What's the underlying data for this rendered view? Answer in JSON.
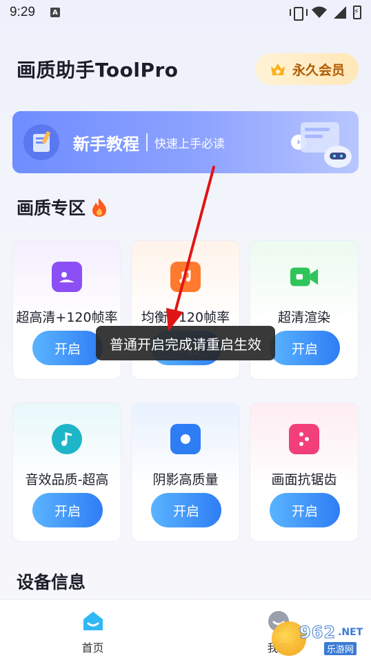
{
  "status_bar": {
    "time": "9:29",
    "notif_letter": "A"
  },
  "header": {
    "title": "画质助手ToolPro",
    "vip_label": "永久会员"
  },
  "tutorial": {
    "title": "新手教程",
    "subtitle": "快速上手必读"
  },
  "quality_section": {
    "title": "画质专区",
    "cards": [
      {
        "label": "超高清+120帧率",
        "button": "开启",
        "icon": "image-icon",
        "color": "#8b4ff5"
      },
      {
        "label": "均衡+120帧率",
        "button": "开启",
        "icon": "music-image-icon",
        "color": "#ff7a2e"
      },
      {
        "label": "超清渲染",
        "button": "开启",
        "icon": "video-camera-icon",
        "color": "#2fc55a"
      },
      {
        "label": "音效品质-超高",
        "button": "开启",
        "icon": "music-note-icon",
        "color": "#1fb5c9"
      },
      {
        "label": "阴影高质量",
        "button": "开启",
        "icon": "record-icon",
        "color": "#2f7df5"
      },
      {
        "label": "画面抗锯齿",
        "button": "开启",
        "icon": "dice-icon",
        "color": "#f23f7a"
      }
    ]
  },
  "toast": {
    "message": "普通开启完成请重启生效"
  },
  "device_section": {
    "title": "设备信息"
  },
  "bottom_nav": {
    "items": [
      {
        "label": "首页",
        "icon": "home-icon",
        "active": true
      },
      {
        "label": "我的",
        "icon": "profile-icon",
        "active": false
      }
    ]
  },
  "watermark": {
    "text": "962",
    "net": ".NET",
    "sub": "乐游网"
  },
  "colors": {
    "accent": "#2f7df5",
    "vip_text": "#b05a00",
    "banner": "#7c92ff",
    "arrow": "#e01515"
  }
}
